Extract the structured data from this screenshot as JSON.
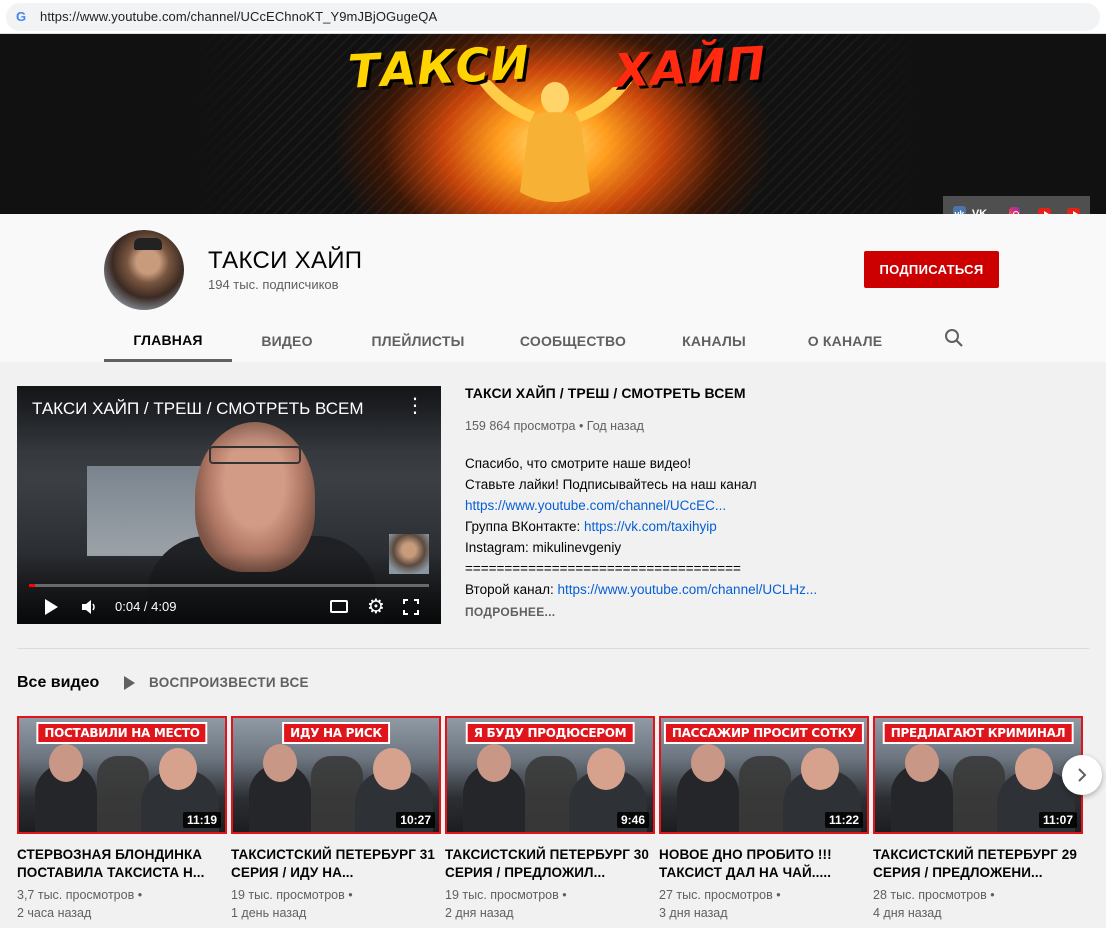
{
  "browser": {
    "url": "https://www.youtube.com/channel/UCcEChnoKT_Y9mJBjOGugeQA"
  },
  "banner": {
    "title_left": "ТАКСИ",
    "title_right": "ХАЙП",
    "links": {
      "vk_label": "VK"
    }
  },
  "channel": {
    "name": "ТАКСИ ХАЙП",
    "subscribers": "194 тыс. подписчиков",
    "subscribe_label": "ПОДПИСАТЬСЯ"
  },
  "tabs": [
    {
      "label": "ГЛАВНАЯ",
      "active": true
    },
    {
      "label": "ВИДЕО"
    },
    {
      "label": "ПЛЕЙЛИСТЫ"
    },
    {
      "label": "СООБЩЕСТВО"
    },
    {
      "label": "КАНАЛЫ"
    },
    {
      "label": "О КАНАЛЕ"
    }
  ],
  "featured": {
    "overlay_title": "ТАКСИ ХАЙП / ТРЕШ / СМОТРЕТЬ ВСЕМ",
    "time": "0:04 / 4:09",
    "progress": 0.016,
    "title": "ТАКСИ ХАЙП / ТРЕШ / СМОТРЕТЬ ВСЕМ",
    "meta": "159 864 просмотра • Год назад",
    "desc_line1": "Спасибо, что смотрите наше видео!",
    "desc_line2": "Ставьте лайки! Подписывайтесь на наш канал",
    "desc_link1": "https://www.youtube.com/channel/UCcEC...",
    "desc_vk_prefix": "Группа ВКонтакте: ",
    "desc_vk_link": "https://vk.com/taxihyip",
    "desc_instagram": "Instagram: mikulinevgeniy",
    "desc_separator": "===================================",
    "desc_second_prefix": "Второй канал: ",
    "desc_second_link": "https://www.youtube.com/channel/UCLHz...",
    "more_label": "ПОДРОБНЕЕ..."
  },
  "section": {
    "title": "Все видео",
    "play_all": "ВОСПРОИЗВЕСТИ ВСЕ"
  },
  "videos": [
    {
      "banner": "ПОСТАВИЛИ НА МЕСТО",
      "duration": "11:19",
      "title": "СТЕРВОЗНАЯ БЛОНДИНКА ПОСТАВИЛА ТАКСИСТА Н...",
      "views": "3,7 тыс. просмотров •",
      "age": "2 часа назад"
    },
    {
      "banner": "ИДУ НА РИСК",
      "duration": "10:27",
      "title": "ТАКСИСТСКИЙ ПЕТЕРБУРГ 31 СЕРИЯ / ИДУ НА...",
      "views": "19 тыс. просмотров •",
      "age": "1 день назад"
    },
    {
      "banner": "Я БУДУ ПРОДЮСЕРОМ",
      "duration": "9:46",
      "title": "ТАКСИСТСКИЙ ПЕТЕРБУРГ 30 СЕРИЯ / ПРЕДЛОЖИЛ...",
      "views": "19 тыс. просмотров •",
      "age": "2 дня назад"
    },
    {
      "banner": "ПАССАЖИР ПРОСИТ СОТКУ",
      "duration": "11:22",
      "title": "НОВОЕ ДНО ПРОБИТО !!! ТАКСИСТ ДАЛ НА ЧАЙ.....",
      "views": "27 тыс. просмотров •",
      "age": "3 дня назад"
    },
    {
      "banner": "ПРЕДЛАГАЮТ КРИМИНАЛ",
      "duration": "11:07",
      "title": "ТАКСИСТСКИЙ ПЕТЕРБУРГ 29 СЕРИЯ / ПРЕДЛОЖЕНИ...",
      "views": "28 тыс. просмотров •",
      "age": "4 дня назад"
    }
  ],
  "colors": {
    "subscribe": "#cc0000",
    "link": "#065fd4",
    "thumb_border": "#e0151b"
  }
}
